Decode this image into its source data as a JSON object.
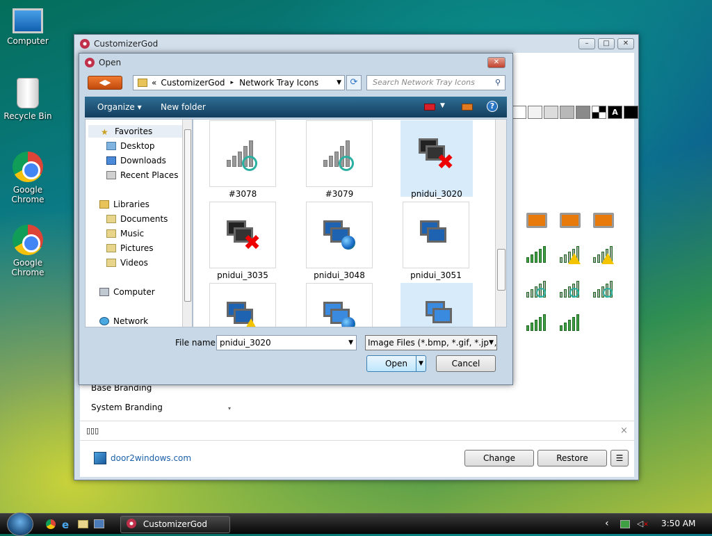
{
  "desktop": {
    "icons": [
      {
        "label": "Computer"
      },
      {
        "label": "Recycle Bin"
      },
      {
        "label": "Google Chrome"
      },
      {
        "label": "Google Chrome"
      }
    ]
  },
  "main_window": {
    "title": "CustomizerGod",
    "branding_items": [
      "Base Branding",
      "System Branding"
    ],
    "status_text": "▯▯▯",
    "close_x": "×",
    "link": "door2windows.com",
    "change_label": "Change",
    "restore_label": "Restore",
    "menu_label": "☰"
  },
  "dialog": {
    "title": "Open",
    "breadcrumb": [
      "«",
      "CustomizerGod",
      "▸",
      "Network Tray Icons"
    ],
    "search_placeholder": "Search Network Tray Icons",
    "toolbar": {
      "organize": "Organize ▾",
      "new_folder": "New folder",
      "help": "?"
    },
    "nav": {
      "favorites": "Favorites",
      "desktop": "Desktop",
      "downloads": "Downloads",
      "recent": "Recent Places",
      "libraries": "Libraries",
      "documents": "Documents",
      "music": "Music",
      "pictures": "Pictures",
      "videos": "Videos",
      "computer": "Computer",
      "network": "Network"
    },
    "files": [
      {
        "name": "#3078"
      },
      {
        "name": "#3079"
      },
      {
        "name": "pnidui_3020"
      },
      {
        "name": "pnidui_3035"
      },
      {
        "name": "pnidui_3048"
      },
      {
        "name": "pnidui_3051"
      }
    ],
    "filename_label": "File name:",
    "filename_value": "pnidui_3020",
    "filetype_value": "Image Files (*.bmp, *.gif, *.jpg,",
    "open_label": "Open",
    "cancel_label": "Cancel"
  },
  "taskbar": {
    "task_label": "CustomizerGod",
    "time": "3:50 AM",
    "tray_arrow": "‹"
  },
  "colors": {
    "accent": "#1d63b2",
    "signal": "#3ea043",
    "warning": "#f5c400",
    "error": "#e00000"
  }
}
